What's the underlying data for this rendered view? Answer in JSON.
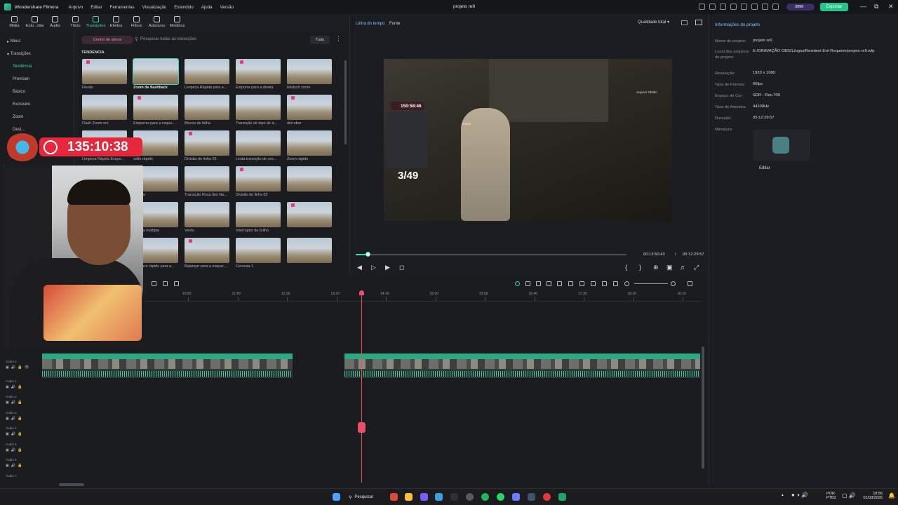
{
  "app": {
    "brand": "Wondershare Filmora",
    "menu": [
      "Arquivo",
      "Editar",
      "Ferramentas",
      "Visualização",
      "Estendido",
      "Ajuda",
      "Versão"
    ],
    "project_title": "projeto re9",
    "credits": "3999",
    "export_label": "Exportar"
  },
  "media_tabs": [
    {
      "label": "Mídia",
      "icon": "media-icon"
    },
    {
      "label": "Esto...idia",
      "icon": "stock-icon"
    },
    {
      "label": "Áudio",
      "icon": "audio-icon"
    },
    {
      "label": "Título",
      "icon": "title-icon"
    },
    {
      "label": "Transições",
      "icon": "transitions-icon"
    },
    {
      "label": "Efeitos",
      "icon": "effects-icon"
    },
    {
      "label": "Filtros",
      "icon": "filters-icon"
    },
    {
      "label": "Adesivos",
      "icon": "stickers-icon"
    },
    {
      "label": "Modelos",
      "icon": "templates-icon"
    }
  ],
  "sidebar": {
    "items": [
      "Meus",
      "Transições",
      "Tendência",
      "Premium",
      "Básico",
      "Exclusivo",
      "Zoom",
      "Desl..."
    ]
  },
  "assets": {
    "center_label": "Centro de ativos",
    "search_placeholder": "Pesquisar todas as transições",
    "filter_label": "Tudo",
    "section_title": "TENDÊNCIA",
    "tiles": [
      "Flexão",
      "Zoom de flashback",
      "Limpeza Rápida para a...",
      "Empurre para a direita",
      "Reduzir zoom",
      "Flash Zoom em",
      "Empurrar para a esque...",
      "Blocos de falha",
      "Transição de bipe de á...",
      "derrubar",
      "Limpeza Rápida Esque...",
      "salto rápido",
      "Divisão de linha 03",
      "Linda transição de ces...",
      "Zoom rápido",
      "...o rápida",
      "Apagar",
      "Transição Roxa dos Na...",
      "Divisão de linha 02",
      "",
      "...a de lente",
      "Panela múltipla",
      "Vento",
      "Interruptor de brilho",
      "",
      "...ack rápido",
      "Empurre rápido para a...",
      "Balançar para a esquer...",
      "Cenoura 1",
      ""
    ]
  },
  "preview": {
    "tab_timeline": "Linha do tempo",
    "tab_source": "Fonte",
    "quality": "Qualidade total",
    "overlay_timer": "150:58:46",
    "overlay_count": "3/49",
    "overlay_save": "Salvar",
    "overlay_small": "Arquivo Obtido",
    "current_time": "00:13:50:43",
    "separator": "/",
    "total_time": "05:12:29:57",
    "progress_fraction": 0.045
  },
  "project_info": {
    "header": "Informações do projeto",
    "rows": [
      {
        "label": "Nome do projeto:",
        "value": "projeto re9"
      },
      {
        "label": "Local dos arquivos do projeto:",
        "value": "E:/GRAVAÇÃO OBS/1Jogos/Resident Evil Requiem/projeto re9.wfp"
      },
      {
        "label": "Resolução:",
        "value": "1920 x 1080"
      },
      {
        "label": "Taxa de Frames:",
        "value": "60fps"
      },
      {
        "label": "Espaço de Cor:",
        "value": "SDR - Rec.709"
      },
      {
        "label": "Taxa de Amostra:",
        "value": "44100Hz"
      },
      {
        "label": "Duração:",
        "value": "05:12:29:57"
      },
      {
        "label": "Miniatura:",
        "value": ""
      }
    ],
    "edit_label": "Editar"
  },
  "timeline": {
    "ruler": [
      "10:50",
      "11:40",
      "12:30",
      "13:20",
      "14:10",
      "15:00",
      "15:50",
      "16:40",
      "17:30",
      "18:20",
      "19:10"
    ],
    "tracks": [
      "Vídeo 1",
      "Áudio 1",
      "Áudio 2",
      "Áudio 3",
      "Áudio 4",
      "Áudio 5",
      "Áudio 6",
      "Áudio 7"
    ],
    "clip_label": "re9"
  },
  "stream_overlay": {
    "timer": "135:10:38"
  },
  "taskbar": {
    "search_label": "Pesquisar",
    "lang": "POR",
    "lang2": "PTB2",
    "time": "18:56",
    "date": "01/03/2026"
  },
  "colors": {
    "accent": "#3fd8b1",
    "export": "#24c389",
    "playhead": "#e8506a",
    "overlay_red": "#e5283c"
  }
}
